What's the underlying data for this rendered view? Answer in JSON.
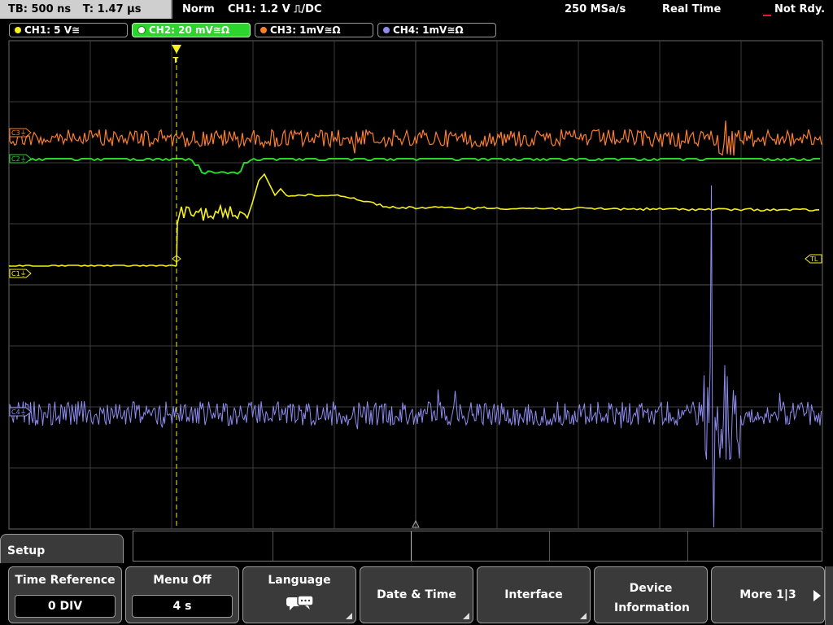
{
  "status_bar": {
    "timebase": "TB: 500 ns",
    "trigger_time": "T: 1.47 µs",
    "trigger_mode": "Norm",
    "trigger_source": "CH1: 1.2 V ⎍/DC",
    "sample_rate": "250 MSa/s",
    "acq_mode": "Real Time",
    "ready_state": "Not Rdy."
  },
  "channels": [
    {
      "label": "CH1: 5 V≅",
      "color": "#f5f01e",
      "active": false
    },
    {
      "label": "CH2: 20 mV≅Ω",
      "color": "#2bd52b",
      "active": true
    },
    {
      "label": "CH3: 1mV≅Ω",
      "color": "#ff7f27",
      "active": false
    },
    {
      "label": "CH4: 1mV≅Ω",
      "color": "#8e8cf0",
      "active": false
    }
  ],
  "markers": {
    "ch1_ground": "C1⏚",
    "ch2_marker": "C2⏚",
    "ch3_marker": "C3⏚",
    "ch4_marker": "C4⏚",
    "trigger_level": "TL",
    "trigger_pos": "T"
  },
  "menu": {
    "title": "Setup",
    "softkeys": [
      {
        "label": "Time Reference",
        "value": "0 DIV"
      },
      {
        "label": "Menu Off",
        "value": "4 s"
      },
      {
        "label": "Language",
        "icon": "speech-bubbles-icon"
      },
      {
        "label": "Date & Time"
      },
      {
        "label": "Interface"
      },
      {
        "label": "Device Information"
      },
      {
        "label": "More 1|3"
      }
    ]
  },
  "colors": {
    "ch1": "#f5f01e",
    "ch2": "#2bd52b",
    "ch3": "#ff7f27",
    "ch4": "#8e8cf0",
    "grid": "#3c3c3c",
    "softkey_bg": "#3a3a3a"
  }
}
